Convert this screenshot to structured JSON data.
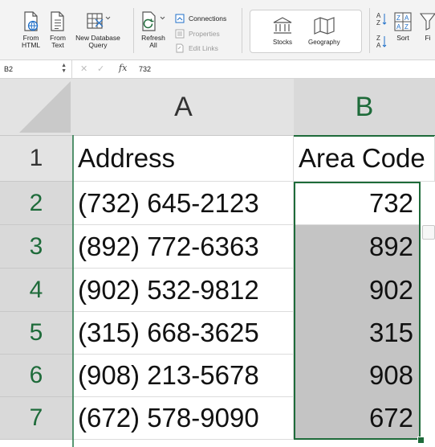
{
  "ribbon": {
    "from_html": {
      "line1": "From",
      "line2": "HTML"
    },
    "from_text": {
      "line1": "From",
      "line2": "Text"
    },
    "new_db_query": {
      "line1": "New Database",
      "line2": "Query"
    },
    "refresh_all": {
      "line1": "Refresh",
      "line2": "All"
    },
    "connections": "Connections",
    "properties": "Properties",
    "edit_links": "Edit Links",
    "stocks": "Stocks",
    "geography": "Geography",
    "sort": "Sort",
    "filter_partial": "Fi"
  },
  "formula_bar": {
    "name_box": "B2",
    "fx_symbol": "fx",
    "cancel_symbol": "✕",
    "enter_symbol": "✓",
    "value": "732"
  },
  "columns": [
    {
      "label": "A"
    },
    {
      "label": "B"
    }
  ],
  "rows": [
    {
      "num": "1",
      "a": "Address",
      "b": "Area Code"
    },
    {
      "num": "2",
      "a": "(732) 645-2123",
      "b": "732"
    },
    {
      "num": "3",
      "a": "(892) 772-6363",
      "b": "892"
    },
    {
      "num": "4",
      "a": "(902) 532-9812",
      "b": "902"
    },
    {
      "num": "5",
      "a": "(315) 668-3625",
      "b": "315"
    },
    {
      "num": "6",
      "a": "(908) 213-5678",
      "b": "908"
    },
    {
      "num": "7",
      "a": "(672) 578-9090",
      "b": "672"
    }
  ],
  "colors": {
    "accent_green": "#1e6b3a",
    "selection_gray": "#c4c4c4",
    "header_gray": "#e3e3e3"
  }
}
